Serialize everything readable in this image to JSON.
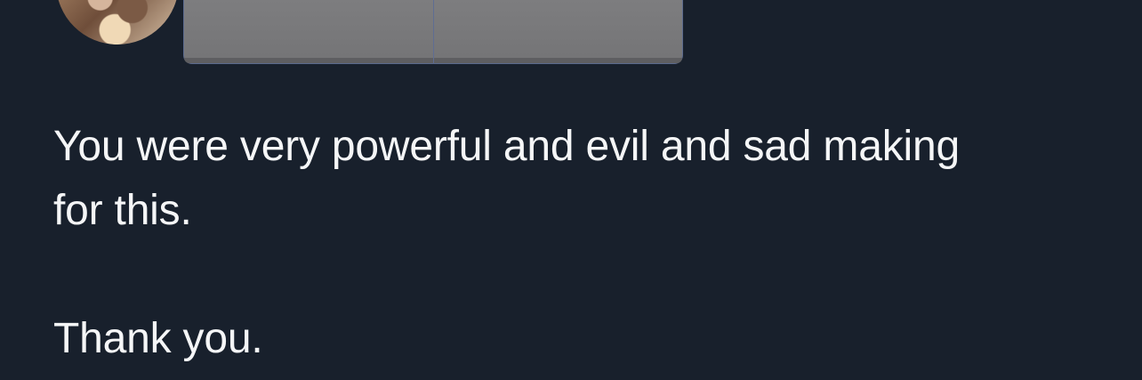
{
  "tweet": {
    "line1": "You were very powerful and evil and sad making",
    "line2": "for this.",
    "line3": "Thank you."
  },
  "avatar": {
    "icon": "user-avatar"
  },
  "media": {
    "tiles": [
      "media-image-1",
      "media-image-2"
    ]
  },
  "colors": {
    "background": "#18202c",
    "text": "#f5f6f7",
    "media_placeholder": "#7e7e80"
  }
}
